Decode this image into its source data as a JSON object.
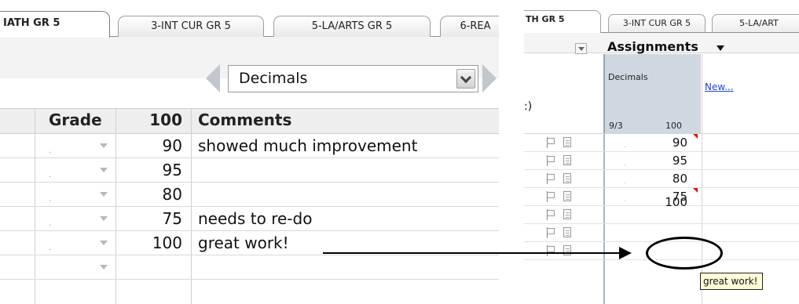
{
  "left": {
    "tabs": [
      {
        "label": "IATH GR 5"
      },
      {
        "label": "3-INT CUR GR 5"
      },
      {
        "label": "5-LA/ARTS GR 5"
      },
      {
        "label": "6-REA"
      }
    ],
    "assignment_select": {
      "value": "Decimals"
    },
    "columns": {
      "grade": "Grade",
      "points": "100",
      "comments": "Comments"
    },
    "rows": [
      {
        "grade": ".",
        "score": "90",
        "comment": "showed much improvement"
      },
      {
        "grade": ".",
        "score": "95",
        "comment": ""
      },
      {
        "grade": ".",
        "score": "80",
        "comment": ""
      },
      {
        "grade": ".",
        "score": "75",
        "comment": "needs to re-do"
      },
      {
        "grade": ".",
        "score": "100",
        "comment": "great work!"
      },
      {
        "grade": "",
        "score": "",
        "comment": ""
      }
    ]
  },
  "right": {
    "tabs": [
      {
        "label": "TH GR 5"
      },
      {
        "label": "3-INT CUR GR 5"
      },
      {
        "label": "5-LA/ART"
      }
    ],
    "assignments_label": "Assignments",
    "assignment_name": "Decimals",
    "assignment_date": "9/3",
    "assignment_points": "100",
    "new_link": "New...",
    "partial_text": ":)",
    "rows": [
      {
        "grade": ".",
        "score": "90"
      },
      {
        "grade": ".",
        "score": "95"
      },
      {
        "grade": ".",
        "score": "80"
      },
      {
        "grade": ".",
        "score": "75"
      },
      {
        "grade": "",
        "score": "100"
      },
      {
        "grade": "",
        "score": ""
      },
      {
        "grade": "",
        "score": ""
      }
    ],
    "tooltip": "great work!"
  }
}
